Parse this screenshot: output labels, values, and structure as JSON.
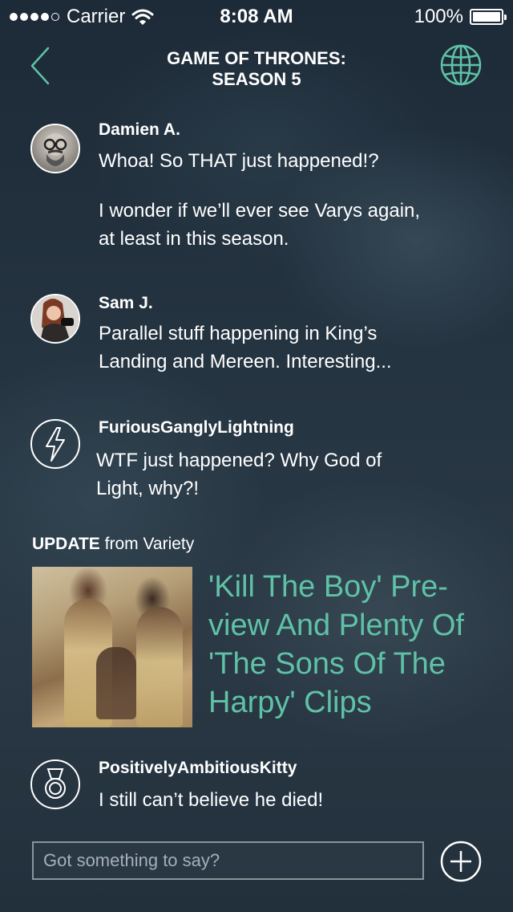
{
  "status_bar": {
    "carrier": "Carrier",
    "time": "8:08 AM",
    "battery": "100%"
  },
  "nav": {
    "title_line1": "GAME OF THRONES:",
    "title_line2": "SEASON 5",
    "back_icon": "chevron-left-icon",
    "globe_icon": "globe-icon",
    "accent_color": "#5fc2a6"
  },
  "comments": [
    {
      "author": "Damien A.",
      "lines": [
        "Whoa! So THAT just happened!?"
      ],
      "extra": [
        "I wonder if we’ll ever see Varys again,",
        "at least in this season."
      ]
    },
    {
      "author": "Sam J.",
      "lines": [
        "Parallel stuff happening in King’s",
        "Landing and Mereen. Interesting..."
      ]
    },
    {
      "author": "FuriousGanglyLightning",
      "lines": [
        "WTF just happened? Why God of",
        "Light, why?!"
      ],
      "icon": "lightning-icon"
    },
    {
      "author": "PositivelyAmbitiousKitty",
      "lines": [
        "I still can’t believe he died!"
      ],
      "icon": "medal-icon"
    }
  ],
  "update": {
    "label_bold": "UPDATE",
    "label_rest": " from Variety",
    "headline_lines": [
      "'Kill The Boy' Pre-",
      "view And Plenty Of",
      "'The Sons Of The",
      "Harpy' Clips"
    ]
  },
  "composer": {
    "placeholder": "Got something to say?",
    "add_icon": "plus-circle-icon"
  }
}
